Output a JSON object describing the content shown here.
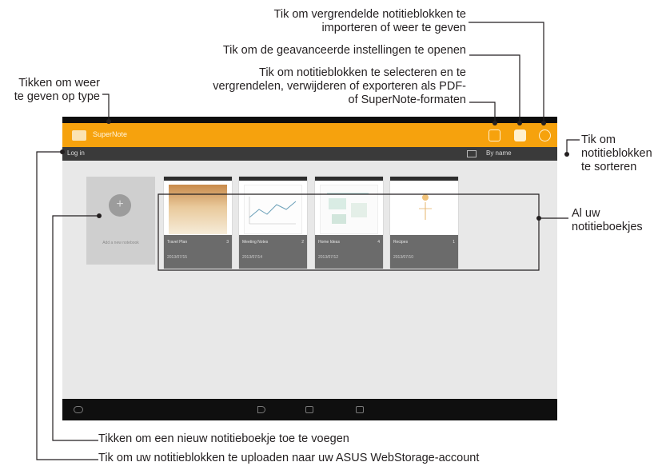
{
  "annotations": {
    "import_locked_line1": "Tik om vergrendelde notitieblokken te",
    "import_locked_line2": "importeren of weer te geven",
    "advanced_settings": "Tik om de geavanceerde instellingen te openen",
    "select_lock_line1": "Tik om notitieblokken te selecteren en te",
    "select_lock_line2": "vergrendelen, verwijderen of exporteren als PDF-",
    "select_lock_line3": "of SuperNote-formaten",
    "view_by_type_line1": "Tikken om weer",
    "view_by_type_line2": "te geven op type",
    "sort_line1": "Tik om",
    "sort_line2": "notitieblokken",
    "sort_line3": "te sorteren",
    "all_notebooks_line1": "Al uw",
    "all_notebooks_line2": "notitieboekjes",
    "add_notebook": "Tikken om een nieuw notitieboekje toe te voegen",
    "upload": "Tik om uw notitieblokken te uploaden naar uw ASUS WebStorage-account"
  },
  "app": {
    "title": "SuperNote",
    "login_label": "Log in",
    "sort_label": "By name",
    "add_label": "Add a new notebook",
    "accent_color": "#f6a20d"
  },
  "notebooks": [
    {
      "name": "Travel Plan",
      "count": "3",
      "date": "2013/07/15"
    },
    {
      "name": "Meeting Notes",
      "count": "2",
      "date": "2013/07/14"
    },
    {
      "name": "Home Ideas",
      "count": "4",
      "date": "2013/07/12"
    },
    {
      "name": "Recipes",
      "count": "1",
      "date": "2013/07/10"
    }
  ],
  "icons": {
    "menu": "app-logo-icon",
    "select": "select-icon",
    "settings": "settings-icon",
    "lock": "lock-icon",
    "back": "back-icon",
    "home": "home-icon",
    "recent": "recent-apps-icon",
    "cloud": "cloud-icon"
  }
}
